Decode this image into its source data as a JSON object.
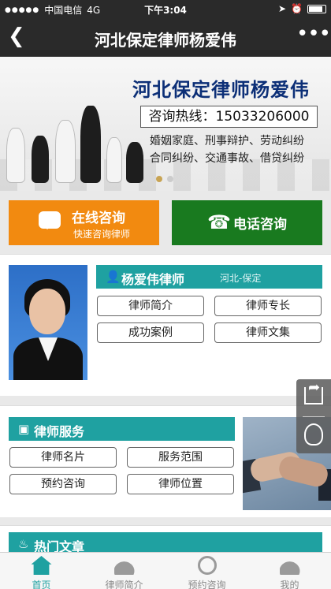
{
  "status_bar": {
    "carrier": "中国电信",
    "network": "4G",
    "time": "下午3:04"
  },
  "nav": {
    "title": "河北保定律师杨爱伟"
  },
  "banner": {
    "headline": "河北保定律师杨爱伟",
    "hotline": "咨询热线：15033206000",
    "tags": [
      "婚姻家庭、刑事辩护、劳动纠纷",
      "合同纠纷、交通事故、借贷纠纷"
    ]
  },
  "consult": {
    "online_title": "在线咨询",
    "online_sub": "快速咨询律师",
    "phone_title": "电话咨询"
  },
  "lawyer": {
    "name": "杨爱伟律师",
    "region": "河北-保定",
    "buttons": [
      "律师简介",
      "律师专长",
      "成功案例",
      "律师文集"
    ]
  },
  "services": {
    "title": "律师服务",
    "buttons": [
      "律师名片",
      "服务范围",
      "预约咨询",
      "律师位置"
    ]
  },
  "articles": {
    "title": "热门文章"
  },
  "tabs": [
    "首页",
    "律师简介",
    "预约咨询",
    "我的"
  ],
  "colors": {
    "teal": "#1fa1a1",
    "orange": "#f28a10",
    "green": "#197a1f",
    "dark": "#2a2a2a"
  }
}
